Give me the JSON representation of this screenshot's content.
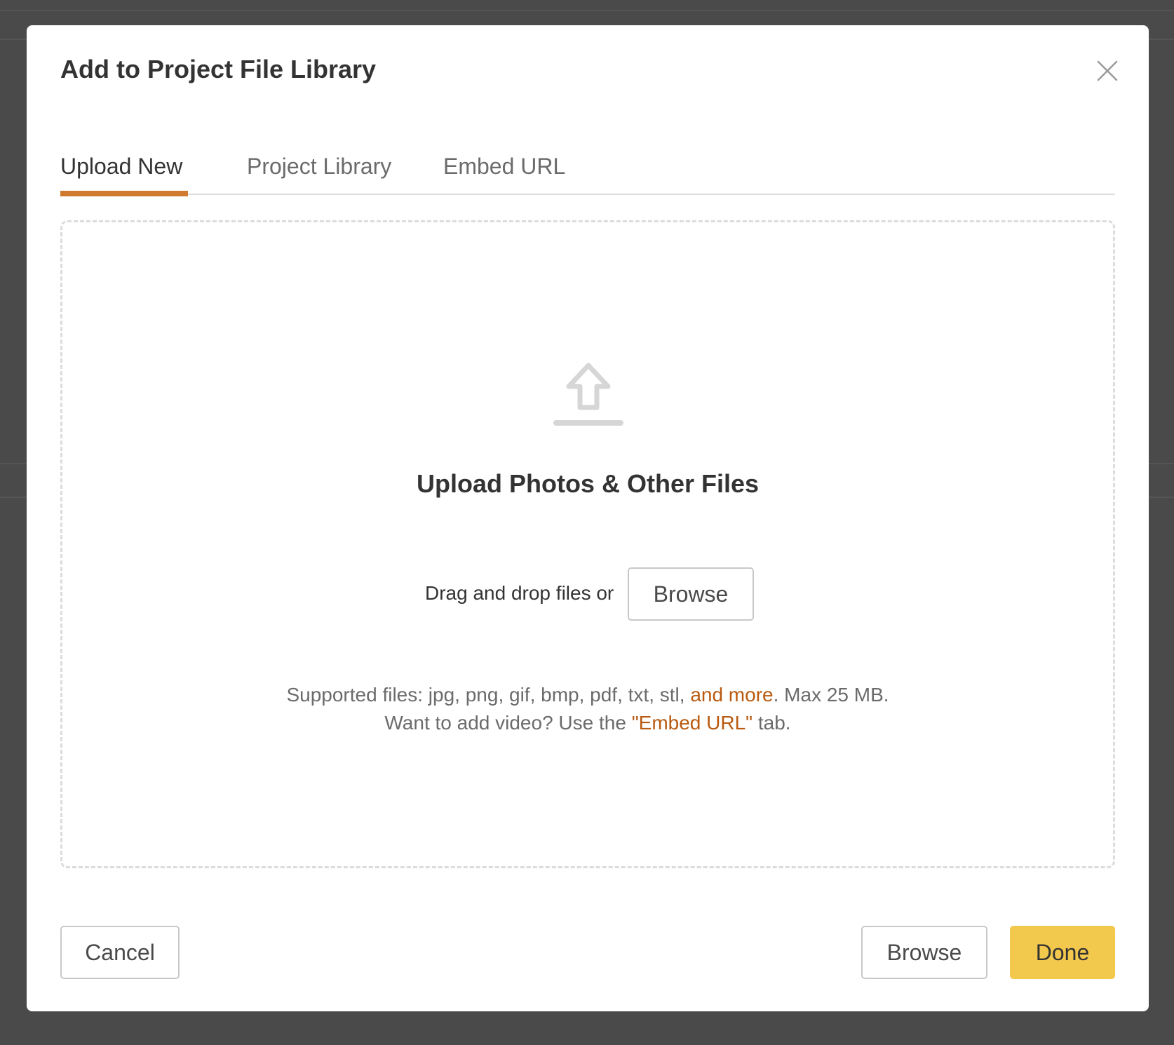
{
  "modal": {
    "title": "Add to Project File Library",
    "close_icon": "close-icon"
  },
  "tabs": [
    {
      "label": "Upload New",
      "active": true
    },
    {
      "label": "Project Library",
      "active": false
    },
    {
      "label": "Embed URL",
      "active": false
    }
  ],
  "dropzone": {
    "icon": "upload-icon",
    "heading": "Upload Photos & Other Files",
    "drag_text": "Drag and drop files or",
    "browse_label": "Browse",
    "supported_prefix": "Supported files: jpg, png, gif, bmp, pdf, txt, stl, ",
    "supported_link": "and more",
    "supported_suffix": ". Max 25 MB.",
    "video_prefix": "Want to add video? Use the ",
    "video_link": "\"Embed URL\"",
    "video_suffix": " tab."
  },
  "footer": {
    "cancel_label": "Cancel",
    "browse_label": "Browse",
    "done_label": "Done"
  },
  "colors": {
    "accent": "#d07a30",
    "link": "#b95a10",
    "done_button": "#f2c94c",
    "overlay": "#4a4a4a"
  }
}
